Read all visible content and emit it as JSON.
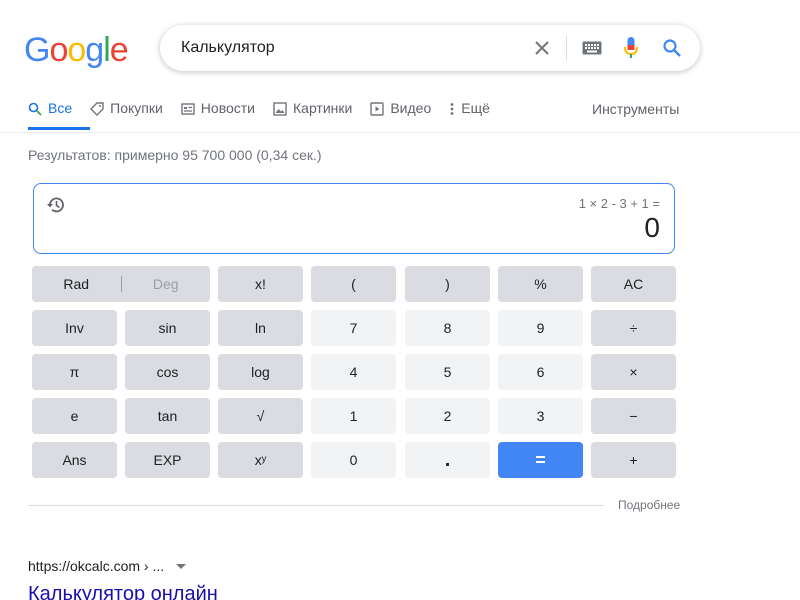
{
  "logo": {
    "letters": [
      "G",
      "o",
      "o",
      "g",
      "l",
      "e"
    ],
    "colors": [
      "#4285f4",
      "#ea4335",
      "#fbbc05",
      "#4285f4",
      "#34a853",
      "#ea4335"
    ]
  },
  "search": {
    "query": "Калькулятор"
  },
  "tabs": [
    {
      "label": "Все",
      "icon": "search-icon"
    },
    {
      "label": "Покупки",
      "icon": "tag-icon"
    },
    {
      "label": "Новости",
      "icon": "news-icon"
    },
    {
      "label": "Картинки",
      "icon": "image-icon"
    },
    {
      "label": "Видео",
      "icon": "video-icon"
    },
    {
      "label": "Ещё",
      "icon": "more-vert-icon"
    }
  ],
  "tools_label": "Инструменты",
  "results_stats": "Результатов: примерно 95 700 000 (0,34 сек.)",
  "calculator": {
    "expression": "1 × 2 - 3 + 1 =",
    "result": "0",
    "rad": "Rad",
    "deg": "Deg",
    "keys": {
      "fact": "x!",
      "lparen": "(",
      "rparen": ")",
      "percent": "%",
      "ac": "AC",
      "inv": "Inv",
      "sin": "sin",
      "ln": "ln",
      "k7": "7",
      "k8": "8",
      "k9": "9",
      "div": "÷",
      "pi": "π",
      "cos": "cos",
      "log": "log",
      "k4": "4",
      "k5": "5",
      "k6": "6",
      "mul": "×",
      "e": "e",
      "tan": "tan",
      "sqrt": "√",
      "k1": "1",
      "k2": "2",
      "k3": "3",
      "minus": "−",
      "ans": "Ans",
      "exp": "EXP",
      "pow": "xʸ",
      "k0": "0",
      "dot": ".",
      "eq": "=",
      "plus": "+"
    }
  },
  "more_label": "Подробнее",
  "first_result": {
    "cite": "https://okcalc.com › ...",
    "title": "Калькулятор онлайн"
  },
  "colors": {
    "accent": "#1a73e8",
    "equals_key": "#4285f4",
    "link": "#1a0dab"
  }
}
